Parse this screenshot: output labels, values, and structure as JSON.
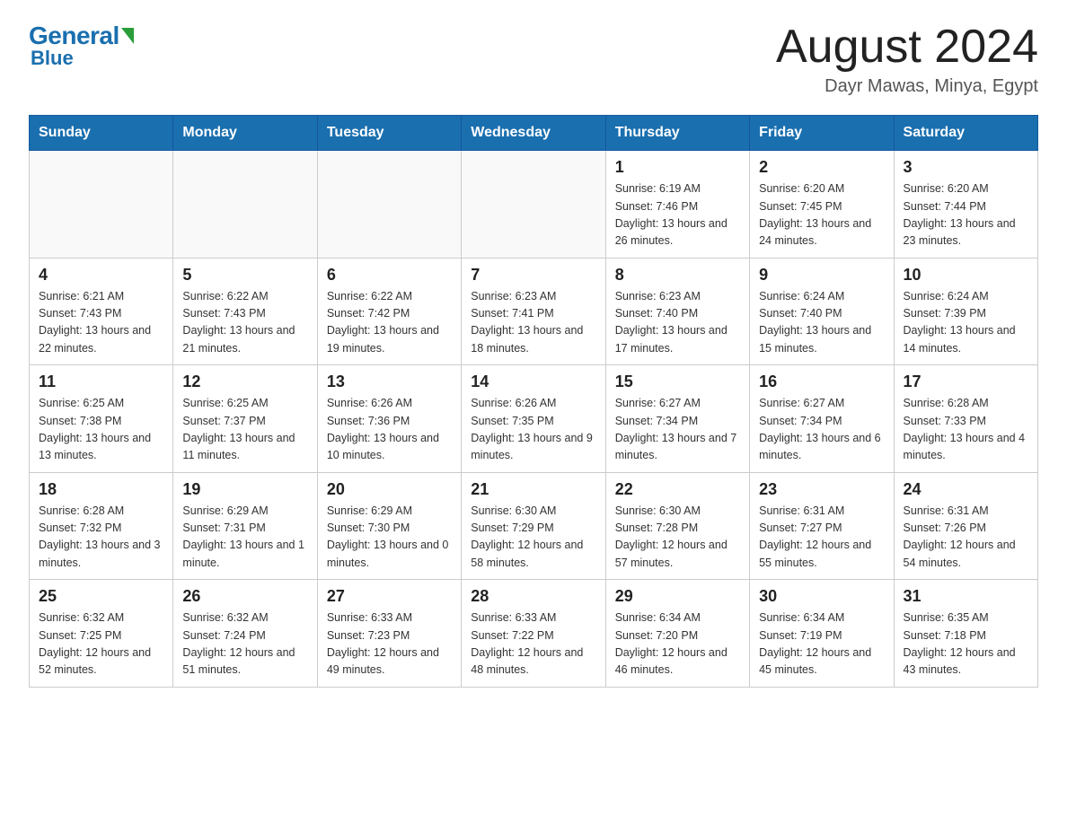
{
  "header": {
    "logo_general": "General",
    "logo_blue": "Blue",
    "month_title": "August 2024",
    "location": "Dayr Mawas, Minya, Egypt"
  },
  "days_of_week": [
    "Sunday",
    "Monday",
    "Tuesday",
    "Wednesday",
    "Thursday",
    "Friday",
    "Saturday"
  ],
  "weeks": [
    [
      {
        "day": "",
        "info": ""
      },
      {
        "day": "",
        "info": ""
      },
      {
        "day": "",
        "info": ""
      },
      {
        "day": "",
        "info": ""
      },
      {
        "day": "1",
        "info": "Sunrise: 6:19 AM\nSunset: 7:46 PM\nDaylight: 13 hours and 26 minutes."
      },
      {
        "day": "2",
        "info": "Sunrise: 6:20 AM\nSunset: 7:45 PM\nDaylight: 13 hours and 24 minutes."
      },
      {
        "day": "3",
        "info": "Sunrise: 6:20 AM\nSunset: 7:44 PM\nDaylight: 13 hours and 23 minutes."
      }
    ],
    [
      {
        "day": "4",
        "info": "Sunrise: 6:21 AM\nSunset: 7:43 PM\nDaylight: 13 hours and 22 minutes."
      },
      {
        "day": "5",
        "info": "Sunrise: 6:22 AM\nSunset: 7:43 PM\nDaylight: 13 hours and 21 minutes."
      },
      {
        "day": "6",
        "info": "Sunrise: 6:22 AM\nSunset: 7:42 PM\nDaylight: 13 hours and 19 minutes."
      },
      {
        "day": "7",
        "info": "Sunrise: 6:23 AM\nSunset: 7:41 PM\nDaylight: 13 hours and 18 minutes."
      },
      {
        "day": "8",
        "info": "Sunrise: 6:23 AM\nSunset: 7:40 PM\nDaylight: 13 hours and 17 minutes."
      },
      {
        "day": "9",
        "info": "Sunrise: 6:24 AM\nSunset: 7:40 PM\nDaylight: 13 hours and 15 minutes."
      },
      {
        "day": "10",
        "info": "Sunrise: 6:24 AM\nSunset: 7:39 PM\nDaylight: 13 hours and 14 minutes."
      }
    ],
    [
      {
        "day": "11",
        "info": "Sunrise: 6:25 AM\nSunset: 7:38 PM\nDaylight: 13 hours and 13 minutes."
      },
      {
        "day": "12",
        "info": "Sunrise: 6:25 AM\nSunset: 7:37 PM\nDaylight: 13 hours and 11 minutes."
      },
      {
        "day": "13",
        "info": "Sunrise: 6:26 AM\nSunset: 7:36 PM\nDaylight: 13 hours and 10 minutes."
      },
      {
        "day": "14",
        "info": "Sunrise: 6:26 AM\nSunset: 7:35 PM\nDaylight: 13 hours and 9 minutes."
      },
      {
        "day": "15",
        "info": "Sunrise: 6:27 AM\nSunset: 7:34 PM\nDaylight: 13 hours and 7 minutes."
      },
      {
        "day": "16",
        "info": "Sunrise: 6:27 AM\nSunset: 7:34 PM\nDaylight: 13 hours and 6 minutes."
      },
      {
        "day": "17",
        "info": "Sunrise: 6:28 AM\nSunset: 7:33 PM\nDaylight: 13 hours and 4 minutes."
      }
    ],
    [
      {
        "day": "18",
        "info": "Sunrise: 6:28 AM\nSunset: 7:32 PM\nDaylight: 13 hours and 3 minutes."
      },
      {
        "day": "19",
        "info": "Sunrise: 6:29 AM\nSunset: 7:31 PM\nDaylight: 13 hours and 1 minute."
      },
      {
        "day": "20",
        "info": "Sunrise: 6:29 AM\nSunset: 7:30 PM\nDaylight: 13 hours and 0 minutes."
      },
      {
        "day": "21",
        "info": "Sunrise: 6:30 AM\nSunset: 7:29 PM\nDaylight: 12 hours and 58 minutes."
      },
      {
        "day": "22",
        "info": "Sunrise: 6:30 AM\nSunset: 7:28 PM\nDaylight: 12 hours and 57 minutes."
      },
      {
        "day": "23",
        "info": "Sunrise: 6:31 AM\nSunset: 7:27 PM\nDaylight: 12 hours and 55 minutes."
      },
      {
        "day": "24",
        "info": "Sunrise: 6:31 AM\nSunset: 7:26 PM\nDaylight: 12 hours and 54 minutes."
      }
    ],
    [
      {
        "day": "25",
        "info": "Sunrise: 6:32 AM\nSunset: 7:25 PM\nDaylight: 12 hours and 52 minutes."
      },
      {
        "day": "26",
        "info": "Sunrise: 6:32 AM\nSunset: 7:24 PM\nDaylight: 12 hours and 51 minutes."
      },
      {
        "day": "27",
        "info": "Sunrise: 6:33 AM\nSunset: 7:23 PM\nDaylight: 12 hours and 49 minutes."
      },
      {
        "day": "28",
        "info": "Sunrise: 6:33 AM\nSunset: 7:22 PM\nDaylight: 12 hours and 48 minutes."
      },
      {
        "day": "29",
        "info": "Sunrise: 6:34 AM\nSunset: 7:20 PM\nDaylight: 12 hours and 46 minutes."
      },
      {
        "day": "30",
        "info": "Sunrise: 6:34 AM\nSunset: 7:19 PM\nDaylight: 12 hours and 45 minutes."
      },
      {
        "day": "31",
        "info": "Sunrise: 6:35 AM\nSunset: 7:18 PM\nDaylight: 12 hours and 43 minutes."
      }
    ]
  ]
}
